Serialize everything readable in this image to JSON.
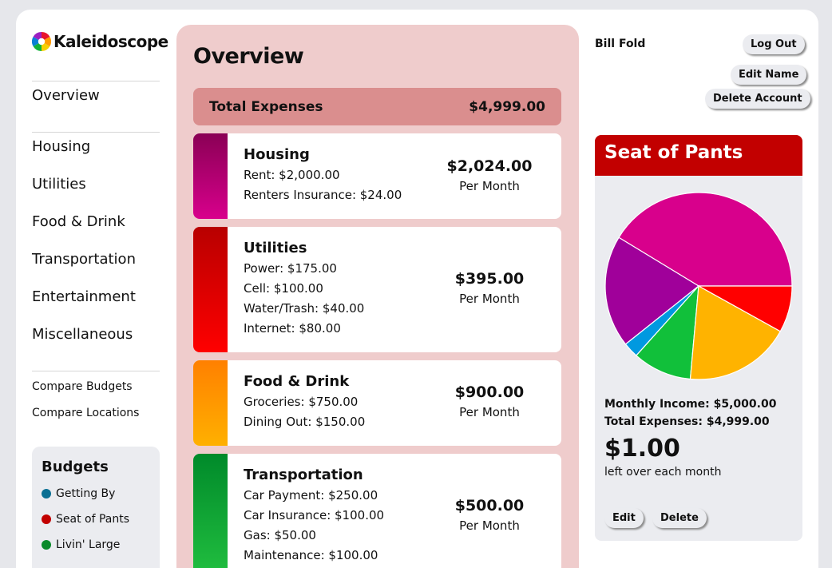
{
  "app": {
    "name": "Kaleidoscope"
  },
  "nav": {
    "overview": "Overview",
    "categories": [
      "Housing",
      "Utilities",
      "Food & Drink",
      "Transportation",
      "Entertainment",
      "Miscellaneous"
    ],
    "compare_budgets": "Compare Budgets",
    "compare_locations": "Compare Locations"
  },
  "budgets": {
    "title": "Budgets",
    "items": [
      {
        "label": "Getting By",
        "color": "#0a6f93"
      },
      {
        "label": "Seat of Pants",
        "color": "#c20000"
      },
      {
        "label": "Livin' Large",
        "color": "#0a8a2a"
      }
    ]
  },
  "overview": {
    "title": "Overview",
    "total_label": "Total Expenses",
    "total_value": "$4,999.00",
    "per_label": "Per Month",
    "categories": [
      {
        "name": "Housing",
        "lines": [
          "Rent: $2,000.00",
          "Renters Insurance: $24.00"
        ],
        "amount": "$2,024.00",
        "color_top": "#8a0055",
        "color_bottom": "#d8008c"
      },
      {
        "name": "Utilities",
        "lines": [
          "Power: $175.00",
          "Cell: $100.00",
          "Water/Trash: $40.00",
          "Internet: $80.00"
        ],
        "amount": "$395.00",
        "color_top": "#b80000",
        "color_bottom": "#ff0000"
      },
      {
        "name": "Food & Drink",
        "lines": [
          "Groceries: $750.00",
          "Dining Out: $150.00"
        ],
        "amount": "$900.00",
        "color_top": "#ff8000",
        "color_bottom": "#ffb000"
      },
      {
        "name": "Transportation",
        "lines": [
          "Car Payment: $250.00",
          "Car Insurance: $100.00",
          "Gas: $50.00",
          "Maintenance: $100.00"
        ],
        "amount": "$500.00",
        "color_top": "#008a2a",
        "color_bottom": "#22c040"
      }
    ]
  },
  "user": {
    "name": "Bill Fold",
    "log_out": "Log Out",
    "edit_name": "Edit Name",
    "delete_account": "Delete Account"
  },
  "budget_panel": {
    "title": "Seat of Pants",
    "header_color": "#c20000",
    "income_line": "Monthly Income: $5,000.00",
    "expenses_line": "Total Expenses: $4,999.00",
    "leftover": "$1.00",
    "leftover_label": "left over each month",
    "edit": "Edit",
    "delete": "Delete"
  },
  "chart_data": {
    "type": "pie",
    "slices": [
      {
        "label": "Housing",
        "value": 2024,
        "color": "#d8008c"
      },
      {
        "label": "Entertainment",
        "value": 950,
        "color": "#a0009a"
      },
      {
        "label": "Miscellaneous",
        "value": 130,
        "color": "#0099e0"
      },
      {
        "label": "Transportation",
        "value": 500,
        "color": "#11c03a"
      },
      {
        "label": "Food & Drink",
        "value": 900,
        "color": "#ffb300"
      },
      {
        "label": "Utilities",
        "value": 395,
        "color": "#ff0000"
      }
    ]
  }
}
